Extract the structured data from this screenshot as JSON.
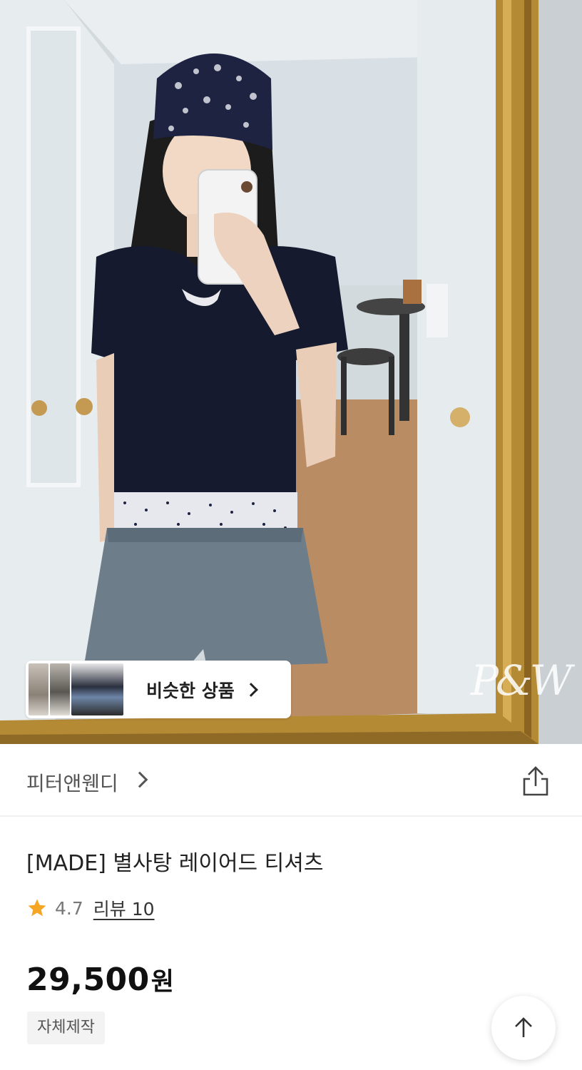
{
  "hero": {
    "watermark": "P&W",
    "similar": {
      "label": "비슷한 상품"
    }
  },
  "brand": {
    "name": "피터앤웬디"
  },
  "product": {
    "title": "[MADE] 별사탕 레이어드 티셔츠",
    "rating": "4.7",
    "review_label": "리뷰 10",
    "price": "29,500",
    "price_unit": "원",
    "tag": "자체제작"
  },
  "colors": {
    "star": "#f5a623",
    "frame": "#b58a35",
    "text_primary": "#111111",
    "text_secondary": "#555555"
  },
  "icons": {
    "share": "share-icon",
    "star": "star-icon",
    "scroll_top": "arrow-up-icon",
    "chevron": "chevron-right-icon"
  }
}
